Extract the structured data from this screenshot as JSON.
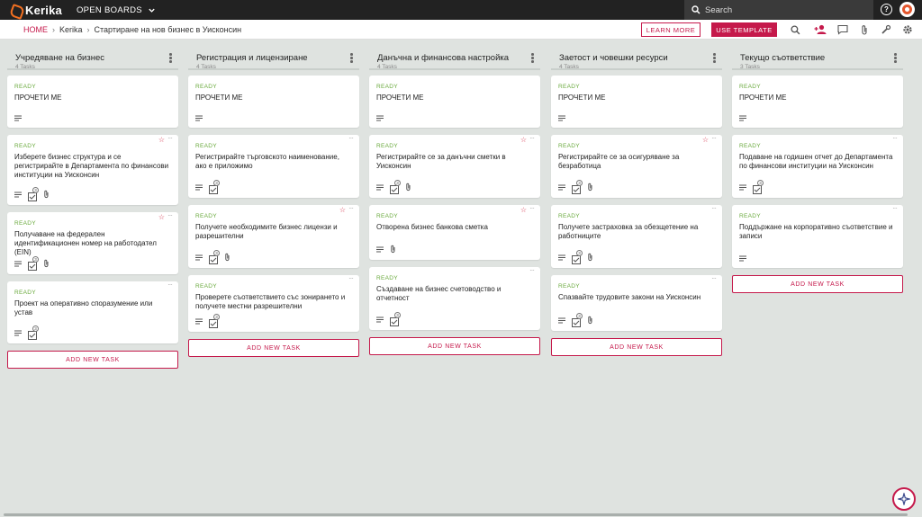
{
  "app": {
    "logo": "Kerika",
    "boards_menu": "OPEN BOARDS"
  },
  "search": {
    "placeholder": "Search"
  },
  "breadcrumb": {
    "home": "HOME",
    "team": "Kerika",
    "board": "Стартиране на нов бизнес в Уисконсин"
  },
  "actions": {
    "learn_more": "LEARN MORE",
    "use_template": "USE TEMPLATE"
  },
  "colors": {
    "accent": "#c5194b",
    "ready": "#6aaa3d",
    "star": "#d6354e"
  },
  "columns": [
    {
      "title": "Учредяване на бизнес",
      "count": "4 Tasks",
      "add": "ADD NEW TASK",
      "cards": [
        {
          "status": "READY",
          "title": "ПРОЧЕТИ МЕ"
        },
        {
          "status": "READY",
          "title": "Изберете бизнес структура и се регистрирайте в Департамента по финансови институции на Уисконсин",
          "subtasks": "3"
        },
        {
          "status": "READY",
          "title": "Получаване на федерален идентификационен номер на работодател (EIN)",
          "subtasks": "3"
        },
        {
          "status": "READY",
          "title": "Проект на оперативно споразумение или устав",
          "subtasks": "3"
        }
      ]
    },
    {
      "title": "Регистрация и лицензиране",
      "count": "4 Tasks",
      "add": "ADD NEW TASK",
      "cards": [
        {
          "status": "READY",
          "title": "ПРОЧЕТИ МЕ"
        },
        {
          "status": "READY",
          "title": "Регистрирайте търговското наименование, ако е приложимо",
          "subtasks": "3"
        },
        {
          "status": "READY",
          "title": "Получете необходимите бизнес лицензи и разрешителни",
          "subtasks": "3"
        },
        {
          "status": "READY",
          "title": "Проверете съответствието със зонирането и получете местни разрешителни",
          "subtasks": "3"
        }
      ]
    },
    {
      "title": "Данъчна и финансова настройка",
      "count": "4 Tasks",
      "add": "ADD NEW TASK",
      "cards": [
        {
          "status": "READY",
          "title": "ПРОЧЕТИ МЕ"
        },
        {
          "status": "READY",
          "title": "Регистрирайте се за данъчни сметки в Уисконсин",
          "subtasks": "3"
        },
        {
          "status": "READY",
          "title": "Отворена бизнес банкова сметка"
        },
        {
          "status": "READY",
          "title": "Създаване на бизнес счетоводство и отчетност",
          "subtasks": "3"
        }
      ]
    },
    {
      "title": "Заетост и човешки ресурси",
      "count": "4 Tasks",
      "add": "ADD NEW TASK",
      "cards": [
        {
          "status": "READY",
          "title": "ПРОЧЕТИ МЕ"
        },
        {
          "status": "READY",
          "title": "Регистрирайте се за осигуряване за безработица",
          "subtasks": "3"
        },
        {
          "status": "READY",
          "title": "Получете застраховка за обезщетение на работниците",
          "subtasks": "3"
        },
        {
          "status": "READY",
          "title": "Спазвайте трудовите закони на Уисконсин",
          "subtasks": "3"
        }
      ]
    },
    {
      "title": "Текущо съответствие",
      "count": "3 Tasks",
      "add": "ADD NEW TASK",
      "cards": [
        {
          "status": "READY",
          "title": "ПРОЧЕТИ МЕ"
        },
        {
          "status": "READY",
          "title": "Подаване на годишен отчет до Департамента по финансови институции на Уисконсин",
          "subtasks": "3"
        },
        {
          "status": "READY",
          "title": "Поддържане на корпоративно съответствие и записи"
        }
      ]
    }
  ]
}
